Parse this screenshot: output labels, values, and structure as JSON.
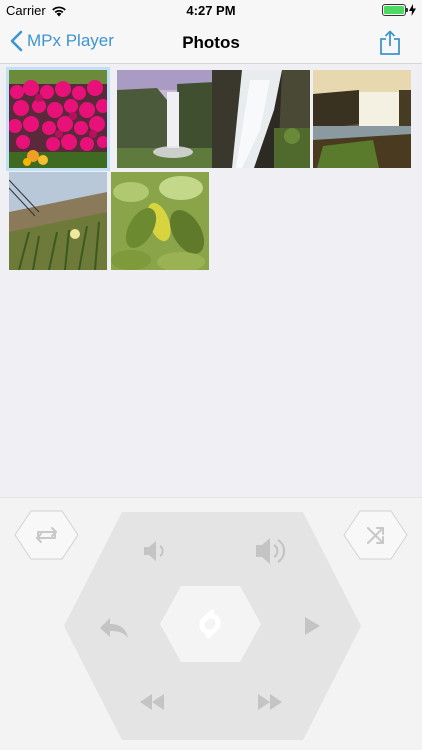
{
  "status": {
    "carrier": "Carrier",
    "time": "4:27 PM",
    "battery_level": 1.0
  },
  "nav": {
    "back_label": "MPx Player",
    "title": "Photos",
    "share_icon": "share-icon",
    "back_icon": "chevron-left-icon"
  },
  "photos": [
    {
      "subject": "pink-flowers",
      "selected": true
    },
    {
      "subject": "waterfall-cliff",
      "selected": false
    },
    {
      "subject": "waterfall-longexposure",
      "selected": false
    },
    {
      "subject": "waterfall-sunset",
      "selected": false
    },
    {
      "subject": "beach-dunes",
      "selected": false
    },
    {
      "subject": "green-leaves",
      "selected": false
    }
  ],
  "remote": {
    "buttons": [
      "repeat-icon",
      "shuffle-icon",
      "volume-down-icon",
      "volume-up-icon",
      "back-icon",
      "play-icon",
      "rewind-icon",
      "fast-forward-icon",
      "link-icon"
    ],
    "accent": "#3d95ce"
  }
}
